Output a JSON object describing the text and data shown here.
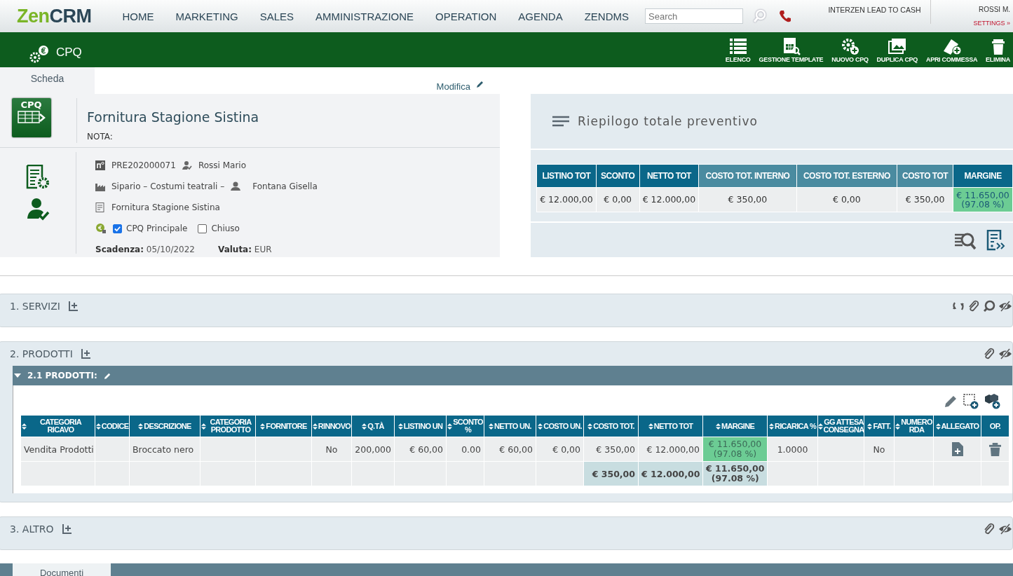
{
  "topbar": {
    "logo": {
      "part_1": "Zen",
      "part_2": "CRM"
    },
    "menu": [
      {
        "label": "HOME"
      },
      {
        "label": "MARKETING"
      },
      {
        "label": "SALES"
      },
      {
        "label": "AMMINISTRAZIONE"
      },
      {
        "label": "OPERATION"
      },
      {
        "label": "AGENDA"
      },
      {
        "label": "ZENDMS"
      }
    ],
    "search": {
      "placeholder": "Search"
    },
    "app_name": "INTERZEN LEAD TO CASH",
    "user": "ROSSI M.",
    "settings": "SETTINGS »"
  },
  "module_bar": {
    "title": "CPQ",
    "actions": [
      {
        "label": "ELENCO"
      },
      {
        "label": "GESTIONE TEMPLATE"
      },
      {
        "label": "NUOVO CPQ"
      },
      {
        "label": "DUPLICA CPQ"
      },
      {
        "label": "APRI COMMESSA"
      },
      {
        "label": "ELIMINA"
      }
    ]
  },
  "record": {
    "tabs": [
      {
        "label": "Scheda",
        "selected": true
      }
    ],
    "edit_link": "Modifica",
    "badge": "CPQ",
    "title": "Fornitura Stagione Sistina",
    "note_label": "NOTA:",
    "number": "PRE202000071",
    "owner": "Rossi Mario",
    "company": "Sipario – Costumi teatrali –",
    "contact": "Fontana Gisella",
    "description": "Fornitura Stagione Sistina",
    "checkboxes": [
      {
        "label": "CPQ Principale",
        "checked": true
      },
      {
        "label": "Chiuso",
        "checked": false
      }
    ],
    "fields": [
      {
        "label": "Scadenza:",
        "value": "05/10/2022"
      },
      {
        "label": "Valuta:",
        "value": "EUR"
      }
    ]
  },
  "summary": {
    "title": "Riepilogo totale preventivo",
    "columns": [
      {
        "label": "LISTINO TOT",
        "color": "#0a6789"
      },
      {
        "label": "SCONTO",
        "color": "#0a6789"
      },
      {
        "label": "NETTO TOT",
        "color": "#0a6789"
      },
      {
        "label": "COSTO TOT. INTERNO",
        "color": "#4a8ba0"
      },
      {
        "label": "COSTO TOT. ESTERNO",
        "color": "#4a8ba0"
      },
      {
        "label": "COSTO TOT",
        "color": "#4a8ba0"
      },
      {
        "label": "MARGINE",
        "color": "#0a6789"
      }
    ],
    "values": [
      {
        "text": "€ 12.000,00",
        "highlight": false
      },
      {
        "text": "€ 0,00",
        "highlight": false
      },
      {
        "text": "€ 12.000,00",
        "highlight": false
      },
      {
        "text": "€ 350,00",
        "highlight": false
      },
      {
        "text": "€ 0,00",
        "highlight": false
      },
      {
        "text": "€ 350,00",
        "highlight": false
      },
      {
        "text": "€ 11.650,00\n(97.08 %)",
        "highlight": true
      }
    ]
  },
  "sections": [
    {
      "title": "1. SERVIZI"
    },
    {
      "title": "2. PRODOTTI",
      "subsection": {
        "title": "2.1 PRODOTTI:",
        "expanded": true,
        "columns": [
          {
            "label": "CATEGORIA RICAVO",
            "sortable": true
          },
          {
            "label": "CODICE",
            "sortable": true
          },
          {
            "label": "DESCRIZIONE",
            "sortable": true
          },
          {
            "label": "CATEGORIA PRODOTTO",
            "sortable": true
          },
          {
            "label": "FORNITORE",
            "sortable": true
          },
          {
            "label": "RINNOVO",
            "sortable": true
          },
          {
            "label": "Q.TÀ",
            "sortable": true
          },
          {
            "label": "LISTINO UN",
            "sortable": true
          },
          {
            "label": "SCONTO %",
            "sortable": true
          },
          {
            "label": "NETTO UN.",
            "sortable": true
          },
          {
            "label": "COSTO UN.",
            "sortable": true
          },
          {
            "label": "COSTO TOT.",
            "sortable": true
          },
          {
            "label": "NETTO TOT",
            "sortable": true
          },
          {
            "label": "MARGINE",
            "sortable": true
          },
          {
            "label": "RICARICA %",
            "sortable": true
          },
          {
            "label": "GG ATTESA CONSEGNA",
            "sortable": true
          },
          {
            "label": "FATT.",
            "sortable": true
          },
          {
            "label": "NUMERO RDA",
            "sortable": true
          },
          {
            "label": "ALLEGATO",
            "sortable": true
          },
          {
            "label": "OP.",
            "sortable": false
          }
        ],
        "rows": [
          {
            "kind": "item",
            "cells": [
              {
                "text": "Vendita Prodotti"
              },
              null,
              {
                "text": "Broccato nero"
              },
              null,
              null,
              {
                "text": "No"
              },
              {
                "text": "200,000"
              },
              {
                "text": "€ 60,00"
              },
              {
                "text": "0.00"
              },
              {
                "text": "€ 60,00"
              },
              {
                "text": "€ 0,00"
              },
              {
                "text": "€ 350,00"
              },
              {
                "text": "€ 12.000,00"
              },
              {
                "text": "€ 11.650,00\n(97.08 %)",
                "highlight": true
              },
              {
                "text": "1.0000"
              },
              null,
              {
                "text": "No"
              },
              null,
              null,
              null
            ]
          },
          {
            "kind": "total",
            "cells": [
              null,
              null,
              null,
              null,
              null,
              null,
              null,
              null,
              null,
              null,
              null,
              {
                "text": "€ 350,00",
                "highlight": true
              },
              {
                "text": "€ 12.000,00",
                "highlight": true
              },
              {
                "text": "€ 11.650,00\n(97.08 %)",
                "highlight": true
              },
              null,
              null,
              null,
              null,
              null,
              null
            ]
          }
        ]
      }
    },
    {
      "title": "3. ALTRO"
    }
  ],
  "bottom_tabs": [
    {
      "label": "Documenti",
      "selected": true
    }
  ]
}
